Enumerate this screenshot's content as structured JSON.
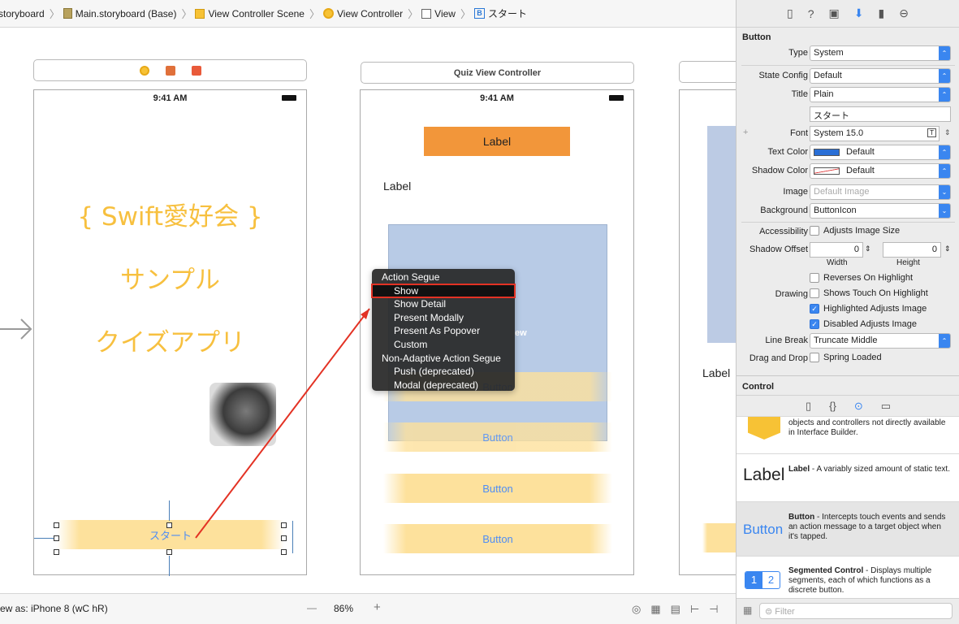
{
  "breadcrumb": {
    "items": [
      "storyboard",
      "Main.storyboard (Base)",
      "View Controller Scene",
      "View Controller",
      "View",
      "スタート"
    ],
    "icons": [
      "",
      "storyboard-file-icon",
      "scene-icon",
      "view-controller-icon",
      "view-icon",
      "button-b-icon"
    ]
  },
  "nav": {
    "back": "<",
    "forward": ">"
  },
  "scene1": {
    "time": "9:41 AM",
    "hero_title": "{ Swift愛好会 }",
    "hero_sub1": "サンプル",
    "hero_sub2": "クイズアプリ",
    "start_button": "スタート"
  },
  "scene2": {
    "title": "Quiz View Controller",
    "time": "9:41 AM",
    "top_label": "Label",
    "label2": "Label",
    "image_hint": "ew",
    "button1": "Button",
    "button2": "Button",
    "button3": "Button",
    "button4": "Button"
  },
  "scene3": {
    "label": "Label"
  },
  "popup": {
    "section1": "Action Segue",
    "items1": [
      "Show",
      "Show Detail",
      "Present Modally",
      "Present As Popover",
      "Custom"
    ],
    "section2": "Non-Adaptive Action Segue",
    "items2": [
      "Push (deprecated)",
      "Modal (deprecated)"
    ]
  },
  "bottom": {
    "view_as": "ew as: iPhone 8 (wC hR)",
    "zoom": "86%",
    "minus": "—",
    "plus": "+"
  },
  "inspector": {
    "section_button": "Button",
    "type_label": "Type",
    "type_value": "System",
    "state_label": "State Config",
    "state_value": "Default",
    "title_label": "Title",
    "title_value": "Plain",
    "title_text": "スタート",
    "font_label": "Font",
    "font_value": "System 15.0",
    "text_color_label": "Text Color",
    "text_color_value": "Default",
    "shadow_color_label": "Shadow Color",
    "shadow_color_value": "Default",
    "image_label": "Image",
    "image_placeholder": "Default Image",
    "background_label": "Background",
    "background_value": "ButtonIcon",
    "accessibility_label": "Accessibility",
    "adjusts_image_size": "Adjusts Image Size",
    "shadow_offset_label": "Shadow Offset",
    "shadow_w": "0",
    "shadow_h": "0",
    "width_label": "Width",
    "height_label": "Height",
    "reverses": "Reverses On Highlight",
    "drawing_label": "Drawing",
    "shows_touch": "Shows Touch On Highlight",
    "highlighted_adjusts": "Highlighted Adjusts Image",
    "disabled_adjusts": "Disabled Adjusts Image",
    "line_break_label": "Line Break",
    "line_break_value": "Truncate Middle",
    "drag_drop_label": "Drag and Drop",
    "spring_loaded": "Spring Loaded",
    "section_control": "Control"
  },
  "library": {
    "obj_text": "objects and controllers not directly available in Interface Builder.",
    "label_title": "Label",
    "label_desc_bold": "Label",
    "label_desc": " - A variably sized amount of static text.",
    "button_title": "Button",
    "button_desc_bold": "Button",
    "button_desc": " - Intercepts touch events and sends an action message to a target object when it's tapped.",
    "seg_desc_bold": "Segmented Control",
    "seg_desc": " - Displays multiple segments, each of which functions as a discrete button.",
    "seg1": "1",
    "seg2": "2",
    "filter_placeholder": "Filter"
  },
  "colors": {
    "accent": "#3a86f0",
    "segue": "#e33224",
    "hero": "#f7c03f",
    "label_bg": "#f2963a"
  }
}
